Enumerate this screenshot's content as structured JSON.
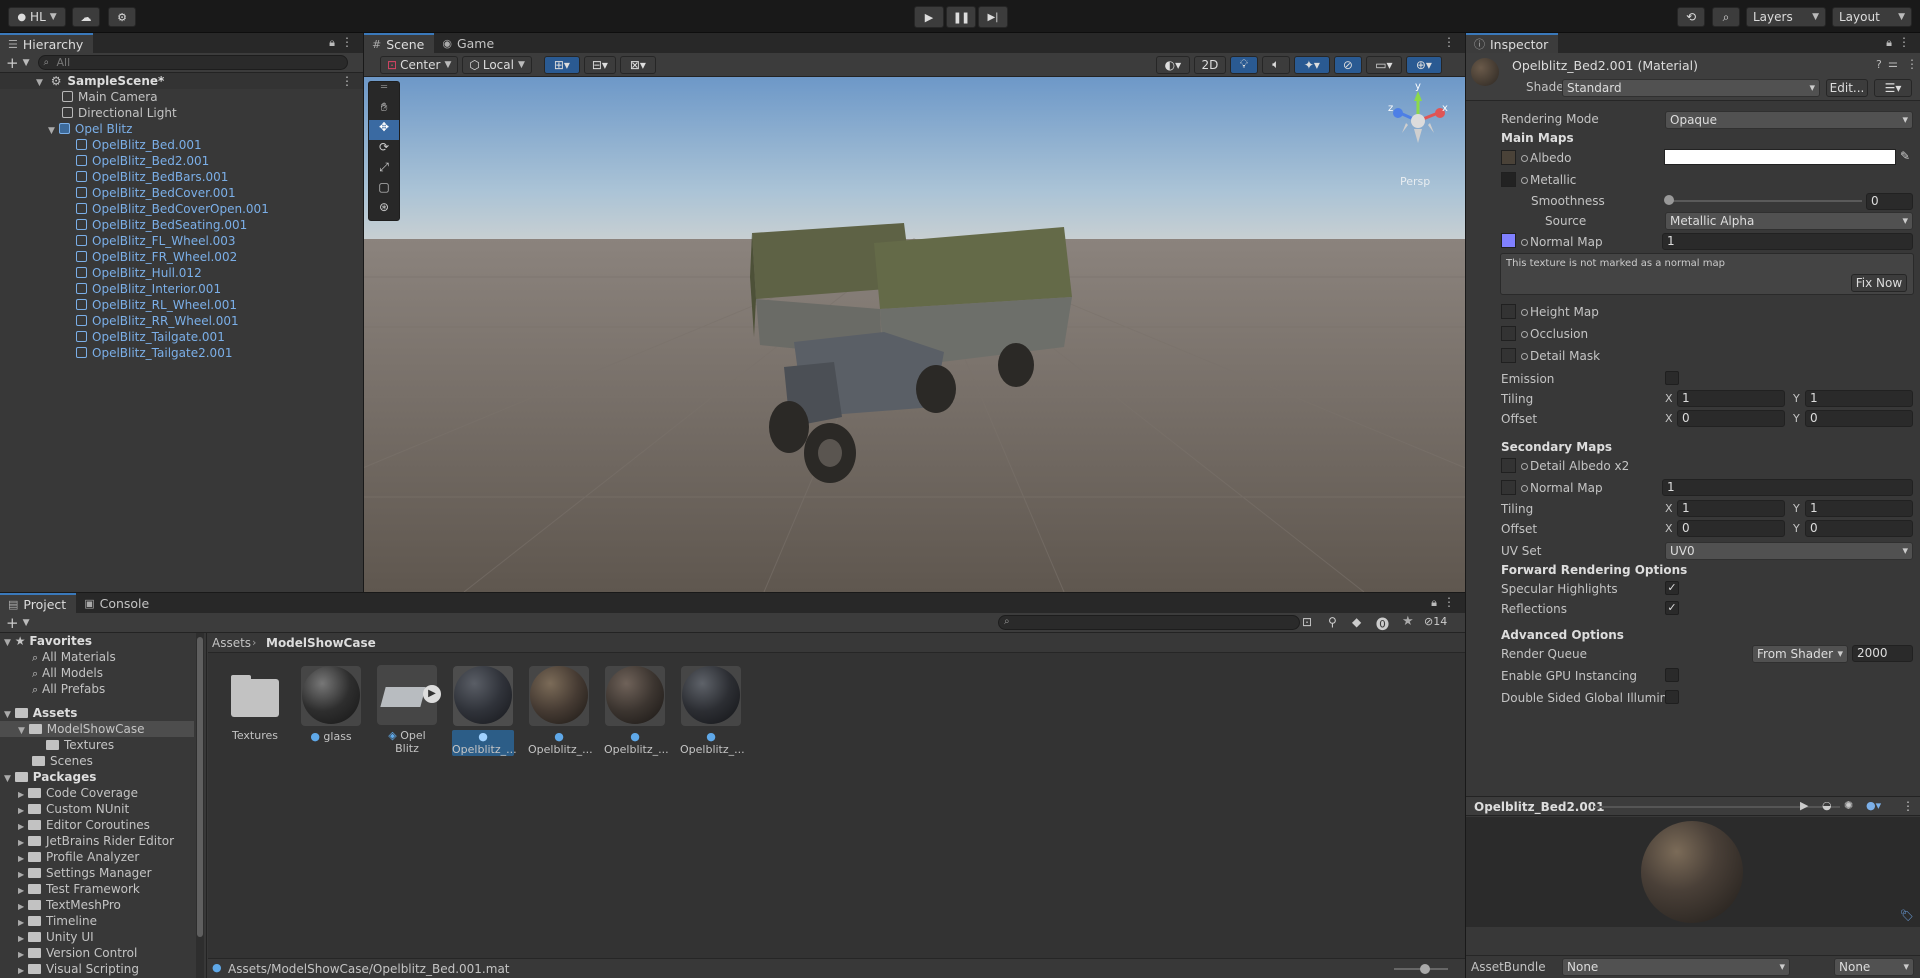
{
  "toolbar": {
    "account": "HL",
    "layers_label": "Layers",
    "layout_label": "Layout"
  },
  "hierarchy": {
    "tab_label": "Hierarchy",
    "search_placeholder": "All",
    "scene_name": "SampleScene*",
    "items": [
      {
        "label": "Main Camera"
      },
      {
        "label": "Directional Light"
      },
      {
        "label": "Opel Blitz"
      }
    ],
    "children": [
      "OpelBlitz_Bed.001",
      "OpelBlitz_Bed2.001",
      "OpelBlitz_BedBars.001",
      "OpelBlitz_BedCover.001",
      "OpelBlitz_BedCoverOpen.001",
      "OpelBlitz_BedSeating.001",
      "OpelBlitz_FL_Wheel.003",
      "OpelBlitz_FR_Wheel.002",
      "OpelBlitz_Hull.012",
      "OpelBlitz_Interior.001",
      "OpelBlitz_RL_Wheel.001",
      "OpelBlitz_RR_Wheel.001",
      "OpelBlitz_Tailgate.001",
      "OpelBlitz_Tailgate2.001"
    ]
  },
  "scene": {
    "tab_scene": "Scene",
    "tab_game": "Game",
    "pivot": "Center",
    "space": "Local",
    "mode_2d": "2D",
    "persp_label": "Persp",
    "gizmo_axes": {
      "x": "x",
      "y": "y",
      "z": "z"
    }
  },
  "inspector": {
    "tab_label": "Inspector",
    "title": "Opelblitz_Bed2.001 (Material)",
    "shader_label": "Shader",
    "shader_value": "Standard",
    "edit_button": "Edit...",
    "rendering_mode_label": "Rendering Mode",
    "rendering_mode_value": "Opaque",
    "main_maps": "Main Maps",
    "albedo": "Albedo",
    "metallic": "Metallic",
    "smoothness": "Smoothness",
    "smoothness_value": "0",
    "source": "Source",
    "source_value": "Metallic Alpha",
    "normal_map": "Normal Map",
    "normal_value": "1",
    "normal_warning": "This texture is not marked as a normal map",
    "fix_now": "Fix Now",
    "height_map": "Height Map",
    "occlusion": "Occlusion",
    "detail_mask": "Detail Mask",
    "emission": "Emission",
    "tiling": "Tiling",
    "offset": "Offset",
    "x": "X",
    "y": "Y",
    "tiling_x": "1",
    "tiling_y": "1",
    "offset_x": "0",
    "offset_y": "0",
    "secondary_maps": "Secondary Maps",
    "detail_albedo": "Detail Albedo x2",
    "normal_map2": "Normal Map",
    "normal_value2": "1",
    "tiling2_x": "1",
    "tiling2_y": "1",
    "offset2_x": "0",
    "offset2_y": "0",
    "uv_set": "UV Set",
    "uv_set_value": "UV0",
    "forward_options": "Forward Rendering Options",
    "specular": "Specular Highlights",
    "reflections": "Reflections",
    "advanced": "Advanced Options",
    "render_queue": "Render Queue",
    "render_queue_source": "From Shader",
    "render_queue_value": "2000",
    "gpu_instancing": "Enable GPU Instancing",
    "double_sided": "Double Sided Global Illuminat",
    "preview_title": "Opelblitz_Bed2.001",
    "asset_bundle_label": "AssetBundle",
    "asset_bundle_value": "None",
    "asset_bundle_variant": "None"
  },
  "project": {
    "tab_project": "Project",
    "tab_console": "Console",
    "hidden_count": "14",
    "favorites": "Favorites",
    "favorite_items": [
      "All Materials",
      "All Models",
      "All Prefabs"
    ],
    "assets": "Assets",
    "assets_children": [
      "ModelShowCase",
      "Textures",
      "Scenes"
    ],
    "packages": "Packages",
    "package_items": [
      "Code Coverage",
      "Custom NUnit",
      "Editor Coroutines",
      "JetBrains Rider Editor",
      "Profile Analyzer",
      "Settings Manager",
      "Test Framework",
      "TextMeshPro",
      "Timeline",
      "Unity UI",
      "Version Control",
      "Visual Scripting"
    ],
    "breadcrumb_root": "Assets",
    "breadcrumb_current": "ModelShowCase",
    "grid_items": [
      "Textures",
      "glass",
      "Opel Blitz",
      "Opelblitz_...",
      "Opelblitz_...",
      "Opelblitz_...",
      "Opelblitz_..."
    ],
    "status_path": "Assets/ModelShowCase/Opelblitz_Bed.001.mat"
  }
}
